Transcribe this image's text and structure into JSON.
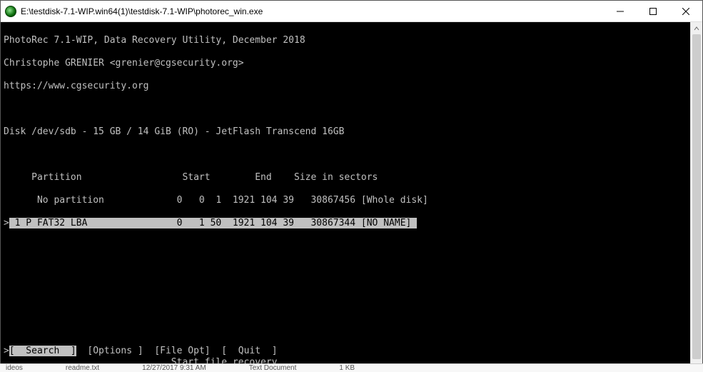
{
  "window": {
    "title": "E:\\testdisk-7.1-WIP.win64(1)\\testdisk-7.1-WIP\\photorec_win.exe"
  },
  "controls": {
    "minimize": "minimize",
    "maximize": "maximize",
    "close": "close"
  },
  "scrollbar": {
    "up": "scroll-up",
    "down": "scroll-down"
  },
  "console": {
    "header": {
      "line1": "PhotoRec 7.1-WIP, Data Recovery Utility, December 2018",
      "line2": "Christophe GRENIER <grenier@cgsecurity.org>",
      "line3": "https://www.cgsecurity.org"
    },
    "disk_line": "Disk /dev/sdb - 15 GB / 14 GiB (RO) - JetFlash Transcend 16GB",
    "table": {
      "header": "     Partition                  Start        End    Size in sectors",
      "row_no_part": "      No partition             0   0  1  1921 104 39   30867456 [Whole disk]",
      "row_sel_pre": ">",
      "row_sel": " 1 P FAT32 LBA                0   1 50  1921 104 39   30867344 [NO NAME] "
    },
    "menu": {
      "sel_pre": ">",
      "search": "[  Search  ]",
      "options": "[Options ]",
      "fileopt": "[File Opt]",
      "quit": "[  Quit  ]",
      "hint": "                              Start file recovery"
    }
  },
  "taskbar": {
    "t1": "ideos",
    "t2": "readme.txt",
    "t3": "12/27/2017 9:31 AM",
    "t4": "Text Document",
    "t5": "1 KB"
  }
}
